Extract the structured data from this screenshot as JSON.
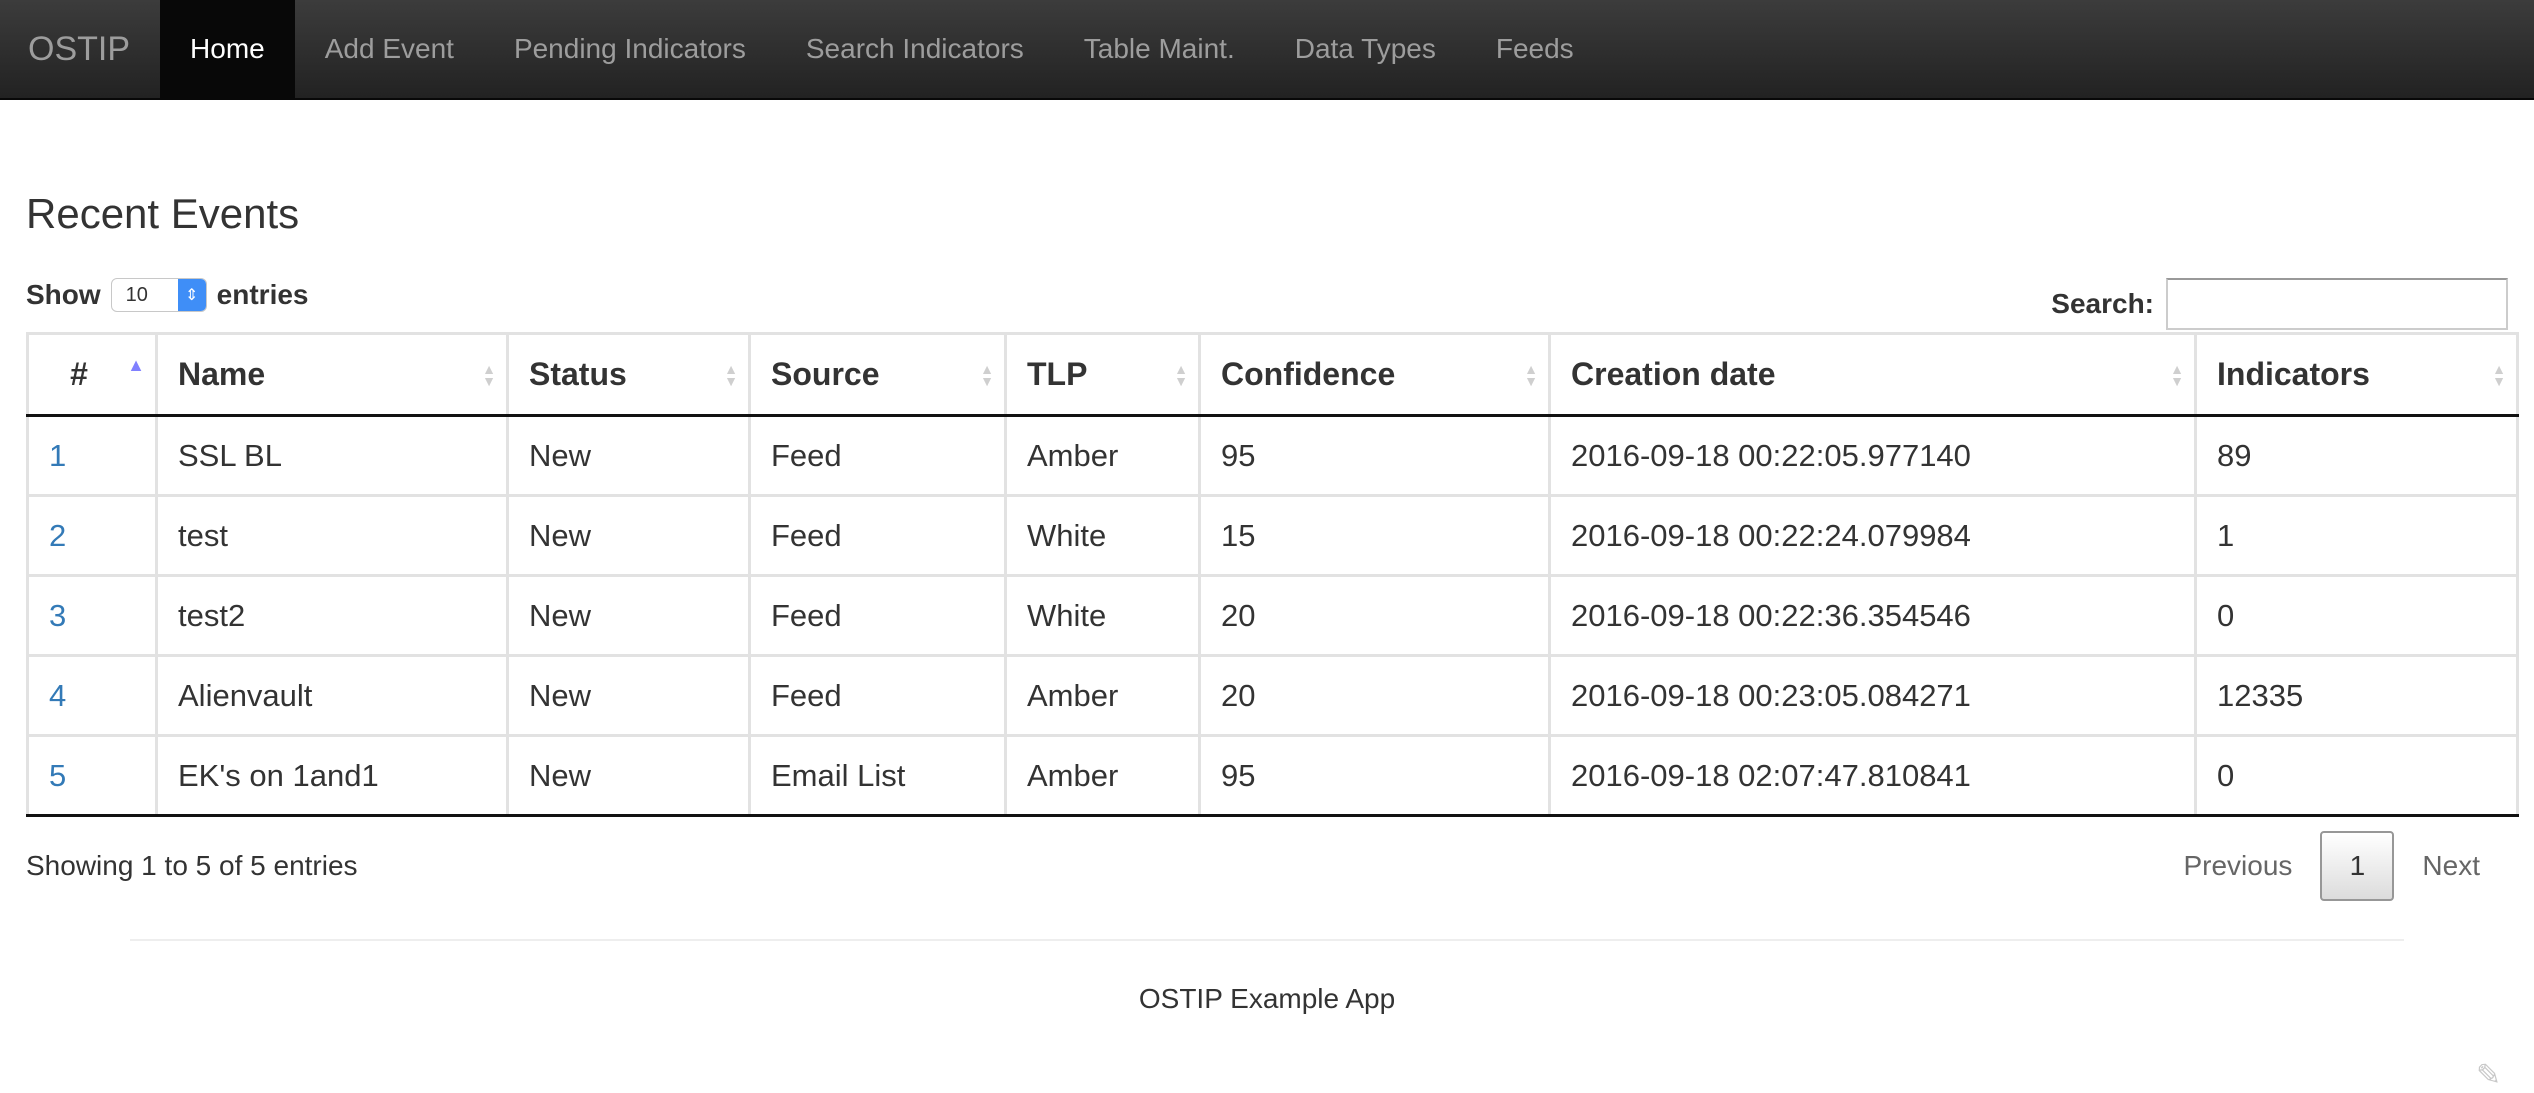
{
  "nav": {
    "brand": "OSTIP",
    "items": [
      {
        "label": "Home",
        "active": true
      },
      {
        "label": "Add Event",
        "active": false
      },
      {
        "label": "Pending Indicators",
        "active": false
      },
      {
        "label": "Search Indicators",
        "active": false
      },
      {
        "label": "Table Maint.",
        "active": false
      },
      {
        "label": "Data Types",
        "active": false
      },
      {
        "label": "Feeds",
        "active": false
      }
    ]
  },
  "page": {
    "title": "Recent Events",
    "show_label": "Show",
    "entries_value": "10",
    "entries_label": "entries",
    "search_label": "Search:",
    "search_value": ""
  },
  "table": {
    "headers": [
      "#",
      "Name",
      "Status",
      "Source",
      "TLP",
      "Confidence",
      "Creation date",
      "Indicators"
    ],
    "rows": [
      [
        "1",
        "SSL BL",
        "New",
        "Feed",
        "Amber",
        "95",
        "2016-09-18 00:22:05.977140",
        "89"
      ],
      [
        "2",
        "test",
        "New",
        "Feed",
        "White",
        "15",
        "2016-09-18 00:22:24.079984",
        "1"
      ],
      [
        "3",
        "test2",
        "New",
        "Feed",
        "White",
        "20",
        "2016-09-18 00:22:36.354546",
        "0"
      ],
      [
        "4",
        "Alienvault",
        "New",
        "Feed",
        "Amber",
        "20",
        "2016-09-18 00:23:05.084271",
        "12335"
      ],
      [
        "5",
        "EK's on 1and1",
        "New",
        "Email List",
        "Amber",
        "95",
        "2016-09-18 02:07:47.810841",
        "0"
      ]
    ]
  },
  "pagination": {
    "info": "Showing 1 to 5 of 5 entries",
    "previous": "Previous",
    "current": "1",
    "next": "Next"
  },
  "footer": {
    "text": "OSTIP Example App"
  },
  "colors": {
    "nav_bg": "#222222",
    "link": "#337ab7",
    "select_accent": "#3f8ef7"
  }
}
